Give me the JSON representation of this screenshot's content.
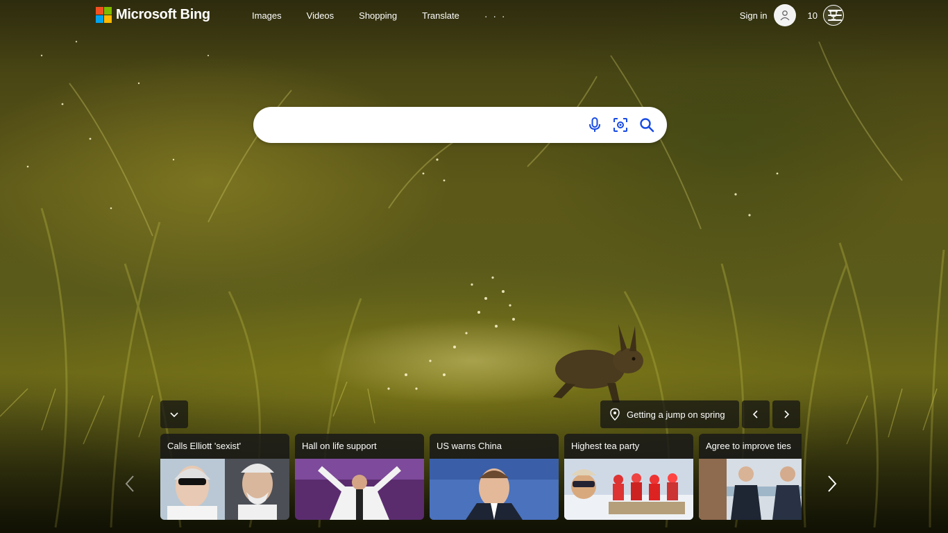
{
  "header": {
    "brand": "Microsoft Bing",
    "nav": [
      "Images",
      "Videos",
      "Shopping",
      "Translate"
    ],
    "more": "· · ·",
    "signin": "Sign in",
    "points": "10"
  },
  "search": {
    "value": "",
    "placeholder": ""
  },
  "image_info": {
    "title": "Getting a jump on spring"
  },
  "news": [
    {
      "title": "Calls Elliott 'sexist'"
    },
    {
      "title": "Hall on life support"
    },
    {
      "title": "US warns China"
    },
    {
      "title": "Highest tea party"
    },
    {
      "title": "Agree to improve ties"
    }
  ],
  "colors": {
    "accent": "#ffffff",
    "search_icon": "#174ae4"
  }
}
